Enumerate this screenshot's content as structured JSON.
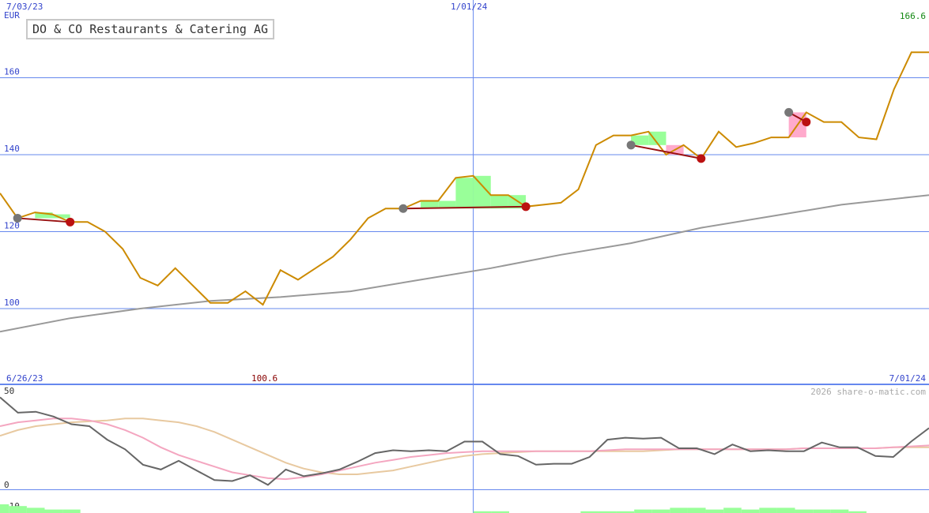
{
  "chart_data": [
    {
      "type": "line",
      "title": "DO & CO Restaurants & Catering AG",
      "currency_label": "EUR",
      "date_labels": {
        "top_left": "7/03/23",
        "top_mid": "1/01/24",
        "bottom_left": "6/26/23",
        "bottom_right": "7/01/24"
      },
      "ylim": [
        76,
        166.6
      ],
      "yticks": [
        100,
        120,
        140,
        160
      ],
      "last_value_label": "166.6",
      "min_value_label": "100.6",
      "grid": true,
      "series": [
        {
          "name": "",
          "color": "#cc8a00",
          "x": [
            "6/26/23",
            "7/03/23",
            "7/10/23",
            "7/17/23",
            "7/24/23",
            "7/31/23",
            "8/07/23",
            "8/14/23",
            "8/21/23",
            "8/28/23",
            "9/04/23",
            "9/11/23",
            "9/18/23",
            "9/25/23",
            "10/02/23",
            "10/09/23",
            "10/16/23",
            "10/23/23",
            "10/30/23",
            "11/06/23",
            "11/13/23",
            "11/20/23",
            "11/27/23",
            "12/04/23",
            "12/11/23",
            "12/18/23",
            "12/25/23",
            "1/01/24",
            "1/08/24",
            "1/15/24",
            "1/22/24",
            "1/29/24",
            "2/05/24",
            "2/12/24",
            "2/19/24",
            "2/26/24",
            "3/04/24",
            "3/11/24",
            "3/18/24",
            "3/25/24",
            "4/01/24",
            "4/08/24",
            "4/15/24",
            "4/22/24",
            "4/29/24",
            "5/06/24",
            "5/13/24",
            "5/20/24",
            "5/27/24",
            "6/03/24",
            "6/10/24",
            "6/17/24",
            "6/24/24",
            "7/01/24"
          ],
          "y": [
            130,
            123.5,
            125,
            124.5,
            122.5,
            122.5,
            120,
            115.5,
            108,
            106,
            110.5,
            106,
            101.5,
            101.5,
            104.5,
            101,
            110,
            107.5,
            110.5,
            113.5,
            118,
            123.5,
            126,
            126,
            128,
            128,
            134,
            134.5,
            129.5,
            129.5,
            126.5,
            127,
            127.5,
            131,
            142.5,
            145,
            145,
            146,
            140,
            142.5,
            139,
            146,
            142,
            143,
            144.5,
            144.5,
            151,
            148.5,
            148.5,
            144.5,
            144,
            157,
            166.6,
            166.6
          ]
        },
        {
          "name": "",
          "color": "#999999",
          "x": [
            "6/26/23",
            "7/24/23",
            "8/21/23",
            "9/18/23",
            "10/16/23",
            "11/13/23",
            "12/11/23",
            "1/08/24",
            "2/05/24",
            "3/04/24",
            "4/01/24",
            "4/29/24",
            "5/27/24",
            "6/24/24",
            "7/01/24"
          ],
          "y": [
            94,
            97.5,
            100,
            102,
            103,
            104.5,
            107.5,
            110.5,
            114,
            117,
            121,
            124,
            127,
            129,
            129.5
          ]
        }
      ],
      "signals": [
        {
          "from_x": "7/03/23",
          "from_y": 123.5,
          "to_x": "7/24/23",
          "to_y": 122.5
        },
        {
          "from_x": "12/04/23",
          "from_y": 126,
          "to_x": "1/22/24",
          "to_y": 126.5
        },
        {
          "from_x": "3/04/24",
          "from_y": 142.5,
          "to_x": "4/01/24",
          "to_y": 139
        },
        {
          "from_x": "5/06/24",
          "from_y": 151,
          "to_x": "5/13/24",
          "to_y": 148.5
        }
      ]
    },
    {
      "type": "line",
      "ylim": [
        -10,
        53
      ],
      "yticks": [
        -10,
        0,
        50
      ],
      "credit": "2026 share-o-matic.com",
      "series": [
        {
          "name": "",
          "color": "#666666",
          "y": [
            48,
            40,
            40.5,
            38,
            34,
            33,
            26,
            21,
            13,
            10.5,
            15,
            10,
            5,
            4.5,
            7.5,
            2.5,
            10.5,
            7,
            8.5,
            10.5,
            14.5,
            19,
            20.5,
            20,
            20.5,
            20,
            25,
            25,
            18.5,
            17.5,
            13,
            13.5,
            13.5,
            17,
            26,
            27,
            26.5,
            27,
            21.5,
            21.5,
            18.5,
            23.5,
            20,
            20.5,
            20,
            20,
            24.5,
            22,
            22,
            17.5,
            17,
            25,
            32
          ]
        },
        {
          "name": "",
          "color": "#f4a6c0",
          "y": [
            33,
            35,
            36,
            37,
            37,
            36,
            34,
            31,
            27,
            22,
            18,
            15,
            12,
            9,
            7.5,
            6,
            5.5,
            6.5,
            8,
            10,
            12,
            14,
            15.5,
            17,
            18,
            19,
            19.5,
            20,
            20,
            20,
            20,
            20,
            20,
            20,
            20.5,
            21,
            21,
            21,
            21,
            21,
            21,
            21,
            21,
            21,
            21,
            21.5,
            21.5,
            21.5,
            21.5,
            21.5,
            22,
            22.5,
            23
          ]
        },
        {
          "name": "",
          "color": "#e8c9a0",
          "y": [
            28,
            31,
            33,
            34,
            35,
            35.5,
            36,
            37,
            37,
            36,
            35,
            33,
            30,
            26,
            22,
            18,
            14,
            11,
            9,
            8,
            8,
            9,
            10,
            12,
            14,
            16,
            17.5,
            18.5,
            19,
            19.5,
            20,
            20,
            20,
            20,
            20,
            20,
            20,
            20.5,
            21,
            21,
            21,
            21,
            21,
            21,
            21,
            21.5,
            21.5,
            21.5,
            21.5,
            21.5,
            22,
            22,
            22
          ]
        }
      ],
      "histogram": [
        5,
        4,
        3,
        2,
        2,
        0,
        0,
        0,
        0,
        0,
        0,
        0,
        0,
        0,
        0,
        0,
        0,
        0,
        0,
        0,
        0,
        0,
        0,
        0,
        0,
        0,
        0,
        1,
        1,
        0,
        0,
        0,
        0,
        1,
        1,
        1,
        2,
        2,
        3,
        3,
        2,
        3,
        2,
        3,
        3,
        2,
        2,
        2,
        1,
        0,
        0,
        0,
        0
      ]
    }
  ]
}
